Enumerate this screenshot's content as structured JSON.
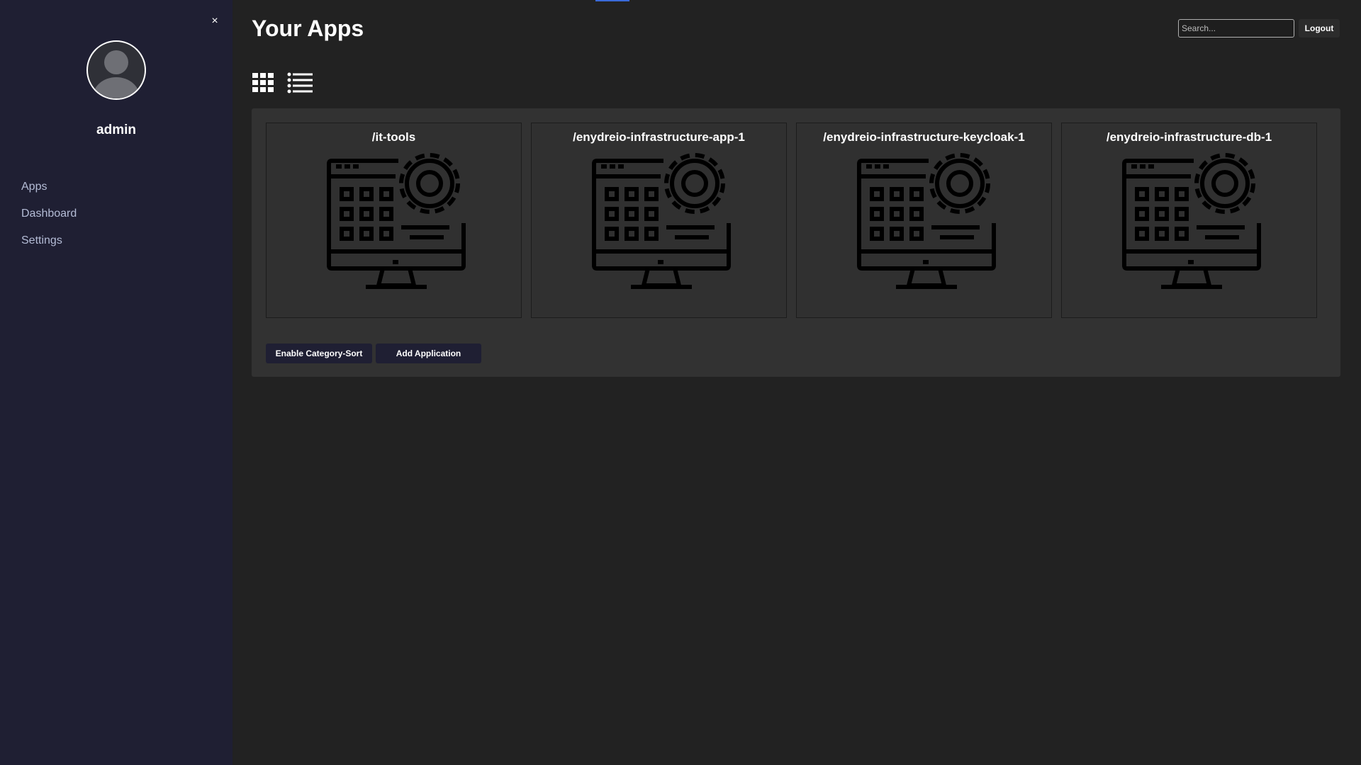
{
  "sidebar": {
    "close_label": "×",
    "username": "admin",
    "nav_items": [
      {
        "label": "Apps"
      },
      {
        "label": "Dashboard"
      },
      {
        "label": "Settings"
      }
    ],
    "background": "#1f1f33"
  },
  "header": {
    "title": "Your Apps",
    "search_placeholder": "Search...",
    "logout_label": "Logout"
  },
  "view_toggles": {
    "grid_icon": "grid-view-icon",
    "list_icon": "list-view-icon"
  },
  "apps": [
    {
      "name": "/it-tools",
      "icon": "app-settings-monitor-icon"
    },
    {
      "name": "/enydreio-infrastructure-app-1",
      "icon": "app-settings-monitor-icon"
    },
    {
      "name": "/enydreio-infrastructure-keycloak-1",
      "icon": "app-settings-monitor-icon"
    },
    {
      "name": "/enydreio-infrastructure-db-1",
      "icon": "app-settings-monitor-icon"
    }
  ],
  "actions": {
    "category_sort_label": "Enable Category-Sort",
    "add_application_label": "Add Application"
  },
  "colors": {
    "page_background": "#222222",
    "panel_background": "#323232",
    "accent": "#3a6ad9"
  }
}
